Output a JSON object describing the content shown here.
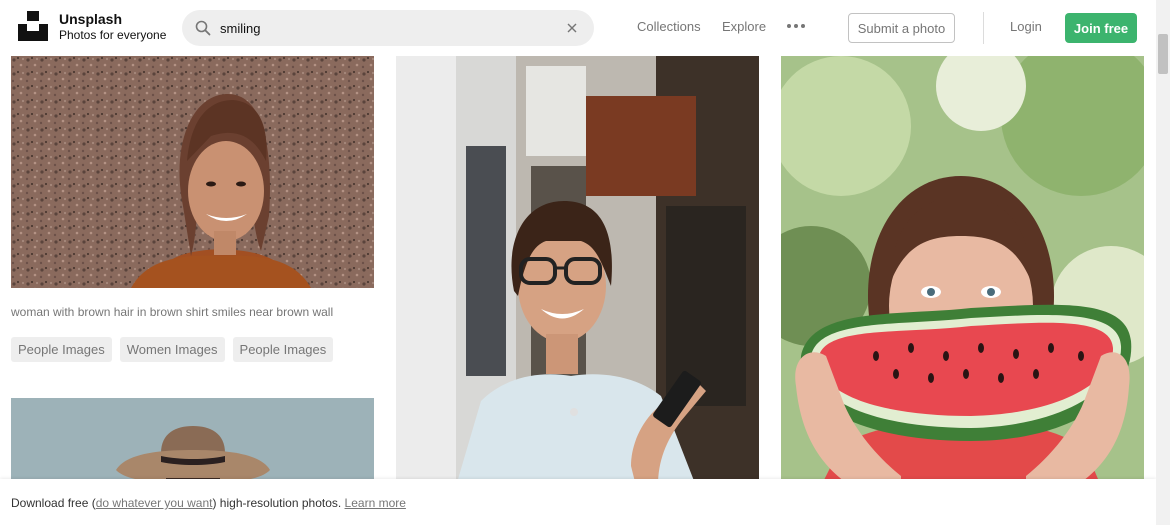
{
  "brand": {
    "name": "Unsplash",
    "tagline": "Photos for everyone"
  },
  "search": {
    "value": "smiling",
    "placeholder": ""
  },
  "nav": {
    "collections": "Collections",
    "explore": "Explore",
    "submit": "Submit a photo",
    "login": "Login",
    "join": "Join free"
  },
  "colors": {
    "accent": "#3cb46e",
    "muted": "#767676",
    "chip": "#eeeeee"
  },
  "icons": [
    "unsplash-logo-icon",
    "search-icon",
    "clear-icon",
    "more-icon"
  ],
  "photos": [
    {
      "id": "photo-1",
      "caption": "woman with brown hair in brown shirt smiles near brown wall",
      "tags": [
        "People Images",
        "Women Images",
        "People Images"
      ]
    },
    {
      "id": "photo-2"
    },
    {
      "id": "photo-3"
    },
    {
      "id": "photo-4"
    }
  ],
  "footer": {
    "prefix": "Download free (",
    "link_license": "do whatever you want",
    "middle": ") high-resolution photos. ",
    "link_learn": "Learn more"
  }
}
